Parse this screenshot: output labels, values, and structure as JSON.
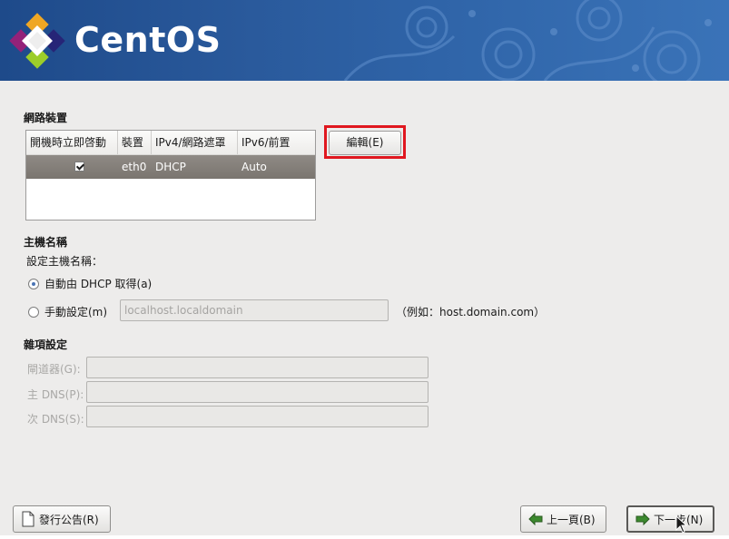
{
  "header": {
    "brand": "CentOS"
  },
  "network_devices": {
    "title": "網路裝置",
    "columns": [
      "開機時立即啓動",
      "裝置",
      "IPv4/網路遮罩",
      "IPv6/前置"
    ],
    "rows": [
      {
        "active_on_boot": true,
        "device": "eth0",
        "ipv4": "DHCP",
        "ipv6": "Auto"
      }
    ],
    "edit_button": "編輯(E)"
  },
  "hostname": {
    "title": "主機名稱",
    "subtitle": "設定主機名稱：",
    "auto_option": "自動由 DHCP 取得(a)",
    "manual_option": "手動設定(m)",
    "manual_value": "localhost.localdomain",
    "example": "（例如：host.domain.com）",
    "selected": "auto"
  },
  "misc": {
    "title": "雜項設定",
    "gateway_label": "閘道器(G):",
    "primary_dns_label": "主 DNS(P):",
    "secondary_dns_label": "次 DNS(S):"
  },
  "footer": {
    "release_notes": "發行公告(R)",
    "back": "上一頁(B)",
    "next": "下一步(N)"
  },
  "colors": {
    "banner": "#2a5a9c",
    "highlight": "#e0171f",
    "selected_row": "#857f79"
  }
}
